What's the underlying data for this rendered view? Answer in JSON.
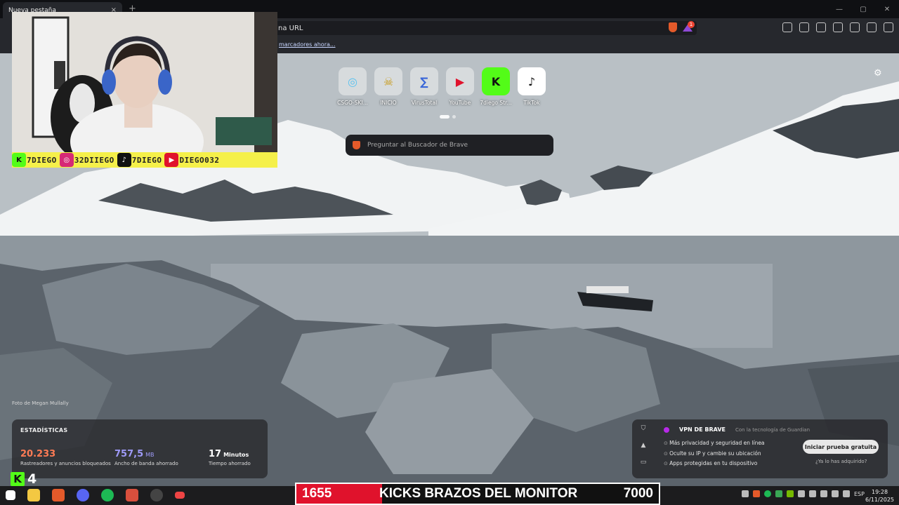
{
  "tab": {
    "title": "Nueva pestaña",
    "close": "×",
    "new_tab": "+"
  },
  "window_buttons": {
    "minimize": "—",
    "maximize": "▢",
    "close": "✕"
  },
  "address_bar": {
    "text": "na URL",
    "rewards_badge": "1"
  },
  "bookmarks_bar": {
    "link": "marcadores ahora..."
  },
  "top_sites": [
    {
      "label": "CSGO-SKI...",
      "icon": "crosshair-icon",
      "color": "#59c2f0"
    },
    {
      "label": "INICIO",
      "icon": "pirate-icon",
      "color": "#f4c542"
    },
    {
      "label": "VirusTotal",
      "icon": "virustotal-icon",
      "color": "#3966d8"
    },
    {
      "label": "YouTube",
      "icon": "youtube-icon",
      "color": "#e0122c"
    },
    {
      "label": "7diego Str...",
      "icon": "kick-icon",
      "color": "#53fc18"
    },
    {
      "label": "TikTok",
      "icon": "tiktok-icon",
      "color": "#111111"
    }
  ],
  "search": {
    "placeholder": "Preguntar al Buscador de Brave"
  },
  "socials": [
    {
      "handle": "7DIEGO",
      "icon": "kick-icon",
      "color": "#53fc18",
      "glyph": "K"
    },
    {
      "handle": "32DIIEGO",
      "icon": "instagram-icon",
      "color": "#d62976",
      "glyph": "◎"
    },
    {
      "handle": "7DIEGO",
      "icon": "tiktok-icon",
      "color": "#111111",
      "glyph": "♪"
    },
    {
      "handle": "DIEGO032",
      "icon": "youtube-icon",
      "color": "#e0122c",
      "glyph": "▶"
    }
  ],
  "photo_credit": "Foto de Megan Mullally",
  "stats": {
    "title": "ESTADÍSTICAS",
    "items": [
      {
        "value": "20.233",
        "unit": "",
        "label": "Rastreadores y anuncios bloqueados",
        "color": "#ff7b54"
      },
      {
        "value": "757,5",
        "unit": "MB",
        "label": "Ancho de banda ahorrado",
        "color": "#9e9af8"
      },
      {
        "value": "17",
        "unit": "Minutos",
        "label": "Tiempo ahorrado",
        "color": "#ffffff"
      }
    ]
  },
  "kick_viewers": {
    "icon_glyph": "K",
    "count": "4"
  },
  "vpn": {
    "title": "VPN DE BRAVE",
    "powered_by": "Con la tecnología de Guardian",
    "features": [
      "Más privacidad y seguridad en línea",
      "Oculte su IP y cambie su ubicación",
      "Apps protegidas en tu dispositivo"
    ],
    "cta": "Iniciar prueba gratuita",
    "already": "¿Ya lo has adquirido?"
  },
  "goal_ticker": {
    "current": "1655",
    "label": "KICKS BRAZOS DEL MONITOR",
    "target": "7000",
    "progress": 0.2365
  },
  "tray": {
    "lang": "ESP",
    "time": "19:28",
    "date": "6/11/2025"
  },
  "colors": {
    "brave_orange": "#e45a2a",
    "kick_green": "#53fc18",
    "overlay_yellow": "#f5f04a",
    "ticker_red": "#e0122c"
  }
}
